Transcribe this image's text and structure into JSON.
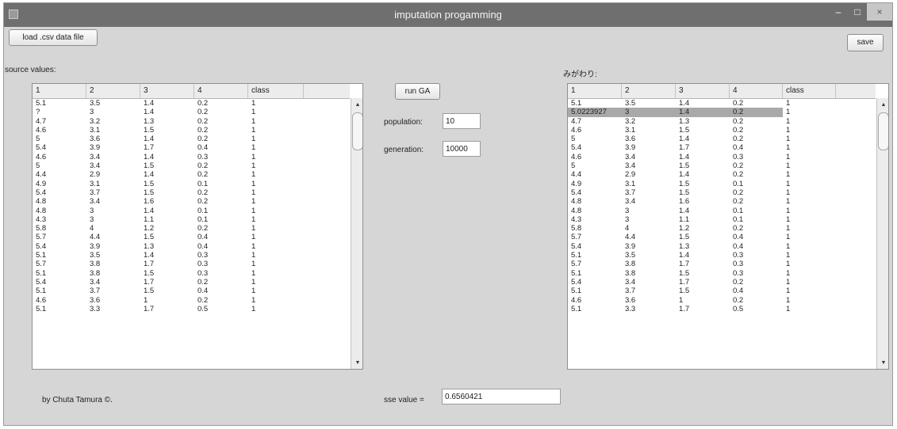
{
  "window": {
    "title": "imputation progamming",
    "minimize": "–",
    "maximize": "□",
    "close": "×"
  },
  "toolbar": {
    "load_label": "load .csv data file",
    "save_label": "save"
  },
  "source": {
    "label": "source values:",
    "columns": [
      "1",
      "2",
      "3",
      "4",
      "class"
    ],
    "rows": [
      [
        "5.1",
        "3.5",
        "1.4",
        "0.2",
        "1"
      ],
      [
        "?",
        "3",
        "1.4",
        "0.2",
        "1"
      ],
      [
        "4.7",
        "3.2",
        "1.3",
        "0.2",
        "1"
      ],
      [
        "4.6",
        "3.1",
        "1.5",
        "0.2",
        "1"
      ],
      [
        "5",
        "3.6",
        "1.4",
        "0.2",
        "1"
      ],
      [
        "5.4",
        "3.9",
        "1.7",
        "0.4",
        "1"
      ],
      [
        "4.6",
        "3.4",
        "1.4",
        "0.3",
        "1"
      ],
      [
        "5",
        "3.4",
        "1.5",
        "0.2",
        "1"
      ],
      [
        "4.4",
        "2.9",
        "1.4",
        "0.2",
        "1"
      ],
      [
        "4.9",
        "3.1",
        "1.5",
        "0.1",
        "1"
      ],
      [
        "5.4",
        "3.7",
        "1.5",
        "0.2",
        "1"
      ],
      [
        "4.8",
        "3.4",
        "1.6",
        "0.2",
        "1"
      ],
      [
        "4.8",
        "3",
        "1.4",
        "0.1",
        "1"
      ],
      [
        "4.3",
        "3",
        "1.1",
        "0.1",
        "1"
      ],
      [
        "5.8",
        "4",
        "1.2",
        "0.2",
        "1"
      ],
      [
        "5.7",
        "4.4",
        "1.5",
        "0.4",
        "1"
      ],
      [
        "5.4",
        "3.9",
        "1.3",
        "0.4",
        "1"
      ],
      [
        "5.1",
        "3.5",
        "1.4",
        "0.3",
        "1"
      ],
      [
        "5.7",
        "3.8",
        "1.7",
        "0.3",
        "1"
      ],
      [
        "5.1",
        "3.8",
        "1.5",
        "0.3",
        "1"
      ],
      [
        "5.4",
        "3.4",
        "1.7",
        "0.2",
        "1"
      ],
      [
        "5.1",
        "3.7",
        "1.5",
        "0.4",
        "1"
      ],
      [
        "4.6",
        "3.6",
        "1",
        "0.2",
        "1"
      ],
      [
        "5.1",
        "3.3",
        "1.7",
        "0.5",
        "1"
      ]
    ]
  },
  "result": {
    "label": "みがわり:",
    "columns": [
      "1",
      "2",
      "3",
      "4",
      "class"
    ],
    "selected_row": 1,
    "rows": [
      [
        "5.1",
        "3.5",
        "1.4",
        "0.2",
        "1"
      ],
      [
        "5.0223927",
        "3",
        "1.4",
        "0.2",
        "1"
      ],
      [
        "4.7",
        "3.2",
        "1.3",
        "0.2",
        "1"
      ],
      [
        "4.6",
        "3.1",
        "1.5",
        "0.2",
        "1"
      ],
      [
        "5",
        "3.6",
        "1.4",
        "0.2",
        "1"
      ],
      [
        "5.4",
        "3.9",
        "1.7",
        "0.4",
        "1"
      ],
      [
        "4.6",
        "3.4",
        "1.4",
        "0.3",
        "1"
      ],
      [
        "5",
        "3.4",
        "1.5",
        "0.2",
        "1"
      ],
      [
        "4.4",
        "2.9",
        "1.4",
        "0.2",
        "1"
      ],
      [
        "4.9",
        "3.1",
        "1.5",
        "0.1",
        "1"
      ],
      [
        "5.4",
        "3.7",
        "1.5",
        "0.2",
        "1"
      ],
      [
        "4.8",
        "3.4",
        "1.6",
        "0.2",
        "1"
      ],
      [
        "4.8",
        "3",
        "1.4",
        "0.1",
        "1"
      ],
      [
        "4.3",
        "3",
        "1.1",
        "0.1",
        "1"
      ],
      [
        "5.8",
        "4",
        "1.2",
        "0.2",
        "1"
      ],
      [
        "5.7",
        "4.4",
        "1.5",
        "0.4",
        "1"
      ],
      [
        "5.4",
        "3.9",
        "1.3",
        "0.4",
        "1"
      ],
      [
        "5.1",
        "3.5",
        "1.4",
        "0.3",
        "1"
      ],
      [
        "5.7",
        "3.8",
        "1.7",
        "0.3",
        "1"
      ],
      [
        "5.1",
        "3.8",
        "1.5",
        "0.3",
        "1"
      ],
      [
        "5.4",
        "3.4",
        "1.7",
        "0.2",
        "1"
      ],
      [
        "5.1",
        "3.7",
        "1.5",
        "0.4",
        "1"
      ],
      [
        "4.6",
        "3.6",
        "1",
        "0.2",
        "1"
      ],
      [
        "5.1",
        "3.3",
        "1.7",
        "0.5",
        "1"
      ]
    ]
  },
  "ga": {
    "run_label": "run GA",
    "population_label": "population:",
    "population_value": "10",
    "generation_label": "generation:",
    "generation_value": "10000"
  },
  "footer": {
    "credit": "by Chuta Tamura ©.",
    "sse_label": "sse value =",
    "sse_value": "0.6560421"
  },
  "colors": {
    "titlebar": "#6f6f6f",
    "window_bg": "#d6d6d6",
    "selection": "#a9a9a9"
  }
}
